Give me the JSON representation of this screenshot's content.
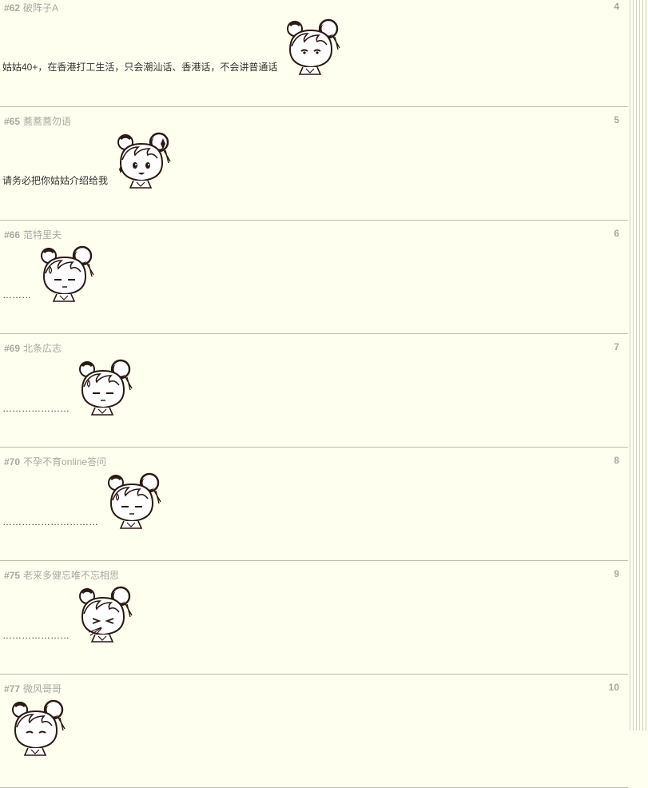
{
  "posts": [
    {
      "id": "#62",
      "author": "破阵子A",
      "floor": "4",
      "text": "姑姑40+，在香港打工生活，只会潮汕话、香港话，不会讲普通话",
      "sticker": "girl-shy-sticker"
    },
    {
      "id": "#65",
      "author": "蕎蕎蕎勿语",
      "floor": "5",
      "text": "请务必把你姑姑介绍给我",
      "sticker": "girl-excited-sticker"
    },
    {
      "id": "#66",
      "author": "范特里夫",
      "floor": "6",
      "text": "………",
      "sticker": "girl-sweat-sticker"
    },
    {
      "id": "#69",
      "author": "北条広志",
      "floor": "7",
      "text": "…………………",
      "sticker": "girl-sweat-sticker"
    },
    {
      "id": "#70",
      "author": "不孕不育online答问",
      "floor": "8",
      "text": "…………………………",
      "sticker": "girl-sweat-sticker"
    },
    {
      "id": "#75",
      "author": "老来多健忘唯不忘相思",
      "floor": "9",
      "text": "…………………",
      "sticker": "girl-spit-sticker"
    },
    {
      "id": "#77",
      "author": "微风哥哥",
      "floor": "10",
      "text": "",
      "sticker": "girl-sticker"
    }
  ]
}
